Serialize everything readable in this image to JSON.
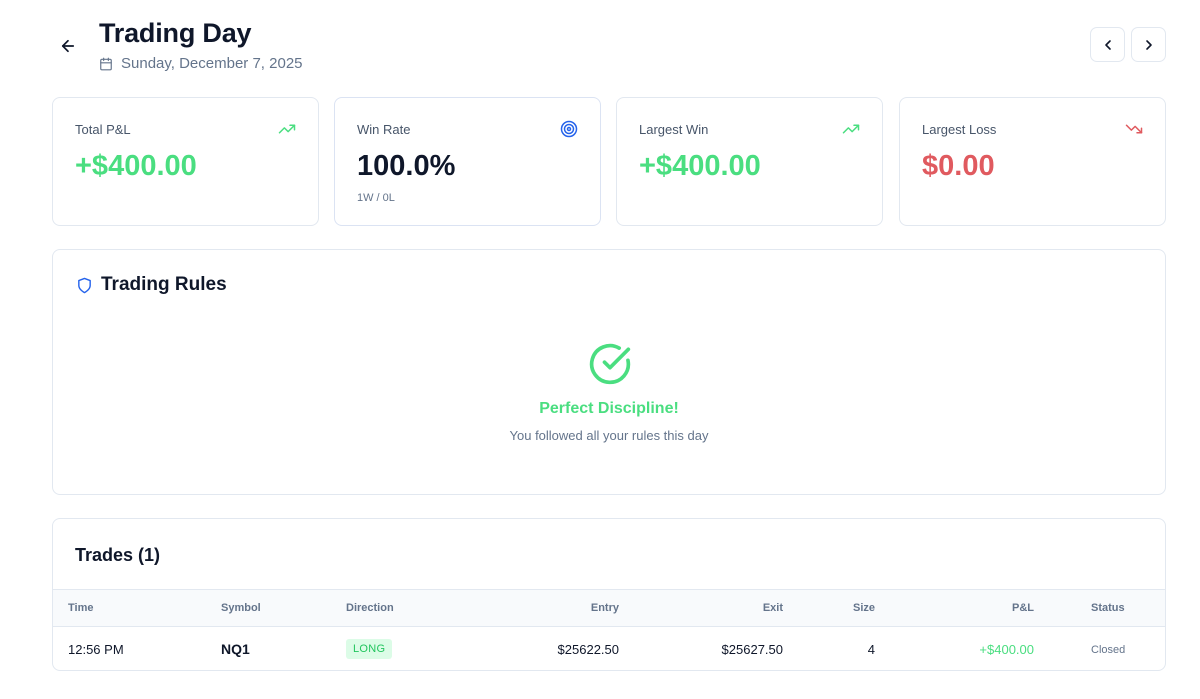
{
  "header": {
    "title": "Trading Day",
    "date": "Sunday, December 7, 2025"
  },
  "stats": [
    {
      "label": "Total P&L",
      "value": "+$400.00",
      "icon": "trending-up-icon"
    },
    {
      "label": "Win Rate",
      "value": "100.0%",
      "sub": "1W / 0L",
      "icon": "target-icon"
    },
    {
      "label": "Largest Win",
      "value": "+$400.00",
      "icon": "trending-up-icon"
    },
    {
      "label": "Largest Loss",
      "value": "$0.00",
      "icon": "trending-down-icon"
    }
  ],
  "rules": {
    "title": "Trading Rules",
    "message": "Perfect Discipline!",
    "submessage": "You followed all your rules this day"
  },
  "trades": {
    "title": "Trades (1)",
    "columns": [
      "Time",
      "Symbol",
      "Direction",
      "Entry",
      "Exit",
      "Size",
      "P&L",
      "Status"
    ],
    "rows": [
      {
        "time": "12:56 PM",
        "symbol": "NQ1",
        "direction": "LONG",
        "entry": "$25622.50",
        "exit": "$25627.50",
        "size": "4",
        "pnl": "+$400.00",
        "status": "Closed"
      }
    ]
  },
  "colors": {
    "positive": "#4ade80",
    "negative": "#e05a5f",
    "accent": "#2563eb"
  }
}
